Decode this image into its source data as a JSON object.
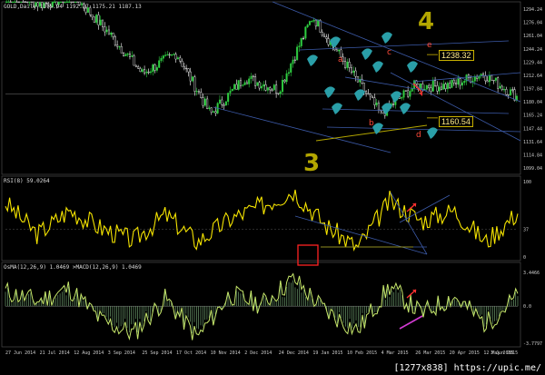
{
  "header": {
    "symbol_line": "GOLD,Daily  1175.94 1192.27 1175.21 1187.13",
    "rsi_line": "RSI(8) 59.0264",
    "macd_line": "OsMA(12,26,9) 1.0469   >MACD(12,26,9) 1.0469"
  },
  "price_levels": {
    "upper_box": "1238.32",
    "lower_box": "1160.54"
  },
  "price_axis": [
    "1294.24",
    "1276.04",
    "1261.04",
    "1244.24",
    "1229.44",
    "1212.64",
    "1197.84",
    "1180.04",
    "1165.24",
    "1147.44",
    "1131.64",
    "1114.84",
    "1099.04"
  ],
  "rsi_axis": [
    "100",
    "37",
    "0"
  ],
  "macd_axis": [
    "3.4466",
    "0.0",
    "-3.7797"
  ],
  "time_axis": [
    "27 Jun 2014",
    "21 Jul 2014",
    "12 Aug 2014",
    "3 Sep 2014",
    "25 Sep 2014",
    "17 Oct 2014",
    "10 Nov 2014",
    "2 Dec 2014",
    "24 Dec 2014",
    "19 Jan 2015",
    "10 Feb 2015",
    "4 Mar 2015",
    "26 Mar 2015",
    "20 Apr 2015",
    "12 May 2015",
    "3 Jun 2015"
  ],
  "wave_labels": [
    "a",
    "b",
    "c",
    "d",
    "e"
  ],
  "big_numbers": [
    "4",
    "3"
  ],
  "watermark": "[1277x838] https://upic.me/",
  "colors": {
    "bull": "#2ecc40",
    "bear": "#ffffff",
    "rsi": "#f5e400",
    "macd_line": "#c7e86b",
    "hist": "#6e9c6e",
    "trendline": "#3c5aa8",
    "wave_label": "#ff4a3a",
    "teal": "#2a9fa8",
    "olive": "#b3a600",
    "box_gold": "#c9b100",
    "red_box": "#ff2222"
  },
  "chart_data": [
    {
      "type": "candlestick",
      "title": "GOLD,Daily",
      "ylim": [
        1099.04,
        1294.24
      ],
      "x": [
        "27 Jun 2014",
        "21 Jul 2014",
        "12 Aug 2014",
        "3 Sep 2014",
        "25 Sep 2014",
        "17 Oct 2014",
        "10 Nov 2014",
        "2 Dec 2014",
        "24 Dec 2014",
        "19 Jan 2015",
        "10 Feb 2015",
        "4 Mar 2015",
        "26 Mar 2015",
        "20 Apr 2015",
        "12 May 2015",
        "3 Jun 2015"
      ],
      "close": [
        1316,
        1300,
        1310,
        1265,
        1215,
        1240,
        1165,
        1210,
        1195,
        1285,
        1225,
        1165,
        1200,
        1200,
        1215,
        1187
      ],
      "levels": [
        1238.32,
        1160.54
      ]
    },
    {
      "type": "line",
      "title": "RSI(8)",
      "ylim": [
        0,
        100
      ],
      "last": 59.0264,
      "values": [
        72,
        30,
        62,
        38,
        22,
        56,
        20,
        50,
        68,
        88,
        42,
        12,
        74,
        48,
        62,
        20,
        59
      ]
    },
    {
      "type": "bar",
      "title": "OsMA(12,26,9)",
      "ylim": [
        -3.7797,
        3.4466
      ],
      "last": 1.0469,
      "values": [
        1.5,
        0.5,
        1.8,
        -1.5,
        -2.8,
        0.8,
        -3.2,
        1.2,
        0.2,
        2.8,
        -0.5,
        -2.5,
        2.0,
        -0.8,
        1.0,
        -1.8,
        1.0
      ]
    }
  ]
}
